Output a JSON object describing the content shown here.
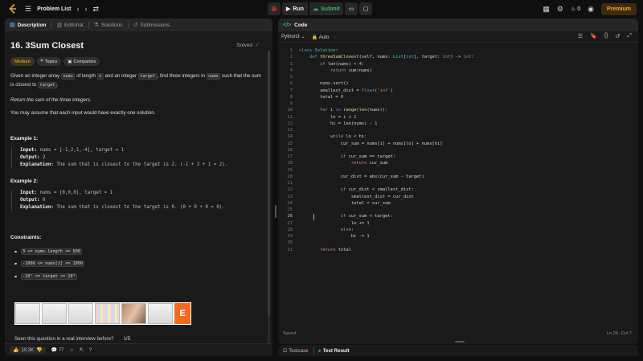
{
  "topbar": {
    "title": "Problem List",
    "run_label": "Run",
    "submit_label": "Submit",
    "streak_count": "0",
    "premium_label": "Premium"
  },
  "left_tabs": [
    "Description",
    "Editorial",
    "Solutions",
    "Submissions"
  ],
  "problem": {
    "title": "16. 3Sum Closest",
    "status": "Solved",
    "difficulty": "Medium",
    "topics_label": "Topics",
    "companies_label": "Companies",
    "p1_a": "Given an integer array ",
    "p1_nums": "nums",
    "p1_b": " of length ",
    "p1_n": "n",
    "p1_c": " and an integer ",
    "p1_target": "target",
    "p1_d": ", find three integers in ",
    "p1_nums2": "nums",
    "p1_e": " such that the sum is closest to ",
    "p1_target2": "target",
    "p1_f": ".",
    "p2": "Return the sum of the three integers.",
    "p3": "You may assume that each input would have exactly one solution."
  },
  "examples": [
    {
      "title": "Example 1:",
      "input_label": "Input:",
      "input": "nums = [-1,2,1,-4], target = 1",
      "output_label": "Output:",
      "output": "2",
      "explanation_label": "Explanation:",
      "explanation": "The sum that is closest to the target is 2. (-1 + 2 + 1 = 2)."
    },
    {
      "title": "Example 2:",
      "input_label": "Input:",
      "input": "nums = [0,0,0], target = 1",
      "output_label": "Output:",
      "output": "0",
      "explanation_label": "Explanation:",
      "explanation": "The sum that is closest to the target is 0. (0 + 0 + 0 = 0)."
    }
  ],
  "constraints": {
    "title": "Constraints:",
    "items": [
      "3 <= nums.length <= 500",
      "-1000 <= nums[i] <= 1000",
      "-10⁴ <= target <= 10⁴"
    ]
  },
  "interview": {
    "question": "Seen this question in a real interview before?",
    "pager": "1/5"
  },
  "footer": {
    "likes": "10.3K",
    "comments": "77"
  },
  "editor": {
    "title": "Code",
    "language": "Python3",
    "auto_label": "Auto",
    "status": "Saved",
    "cursor": "Ln 26, Col 7",
    "current_line": 26,
    "lines": [
      "class Solution:",
      "    def threeSumClosest(self, nums: List[int], target: int) -> int:",
      "        if len(nums) < 4:",
      "            return sum(nums)",
      "",
      "        nums.sort()",
      "        smallest_dist = float('inf')",
      "        total = 0",
      "",
      "        for i in range(len(nums)):",
      "            lo = i + 1",
      "            hi = len(nums) - 1",
      "",
      "            while lo < hi:",
      "                cur_sum = nums[i] + nums[lo] + nums[hi]",
      "",
      "                if cur_sum == target:",
      "                    return cur_sum",
      "",
      "                cur_dist = abs(cur_sum - target)",
      "",
      "                if cur_dist < smallest_dist:",
      "                    smallest_dist = cur_dist",
      "                    total = cur_sum",
      "",
      "                if cur_sum < target:",
      "                    lo += 1",
      "                else:",
      "                    hi -= 1",
      "",
      "        return total"
    ]
  },
  "testpanel": {
    "testcase_label": "Testcase",
    "result_label": "Test Result"
  },
  "colors": {
    "accent_green": "#2cbb5d",
    "medium": "#ffb800",
    "premium": "#ffa116",
    "link_blue": "#4a90e2"
  }
}
